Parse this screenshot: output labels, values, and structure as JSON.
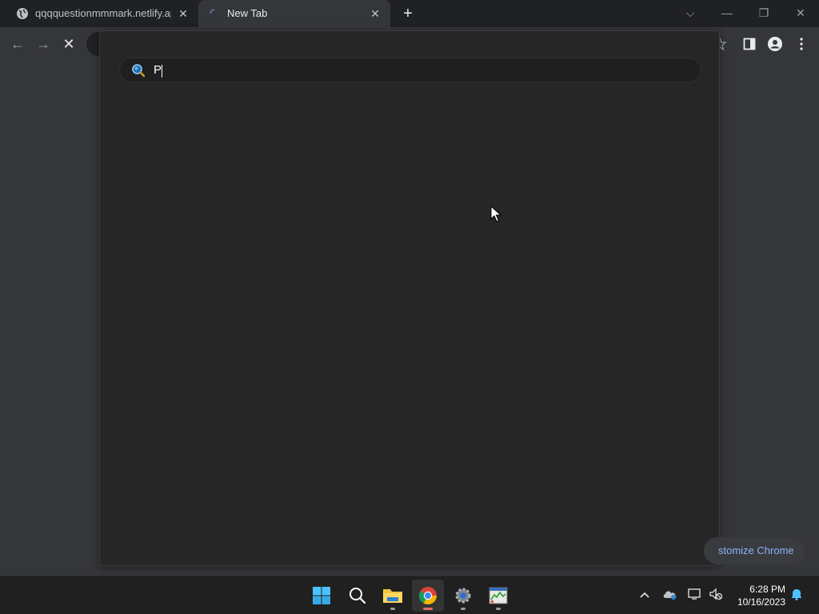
{
  "browser": {
    "tabs": [
      {
        "label": "qqqquestionmmmark.netlify.app",
        "state": "inactive"
      },
      {
        "label": "New Tab",
        "state": "active-loading"
      }
    ],
    "new_tab_symbol": "+",
    "window_controls": {
      "tab_search": "⌵",
      "minimize": "—",
      "restore": "❐",
      "close": "✕"
    }
  },
  "toolbar": {
    "back_symbol": "←",
    "forward_symbol": "→",
    "stop_symbol": "✕",
    "icons": [
      "star-icon",
      "side-panel-icon",
      "profile-icon",
      "menu-icon"
    ]
  },
  "search_popup": {
    "query": "P",
    "search_icon": "search-icon"
  },
  "customize_button": {
    "label": "stomize Chrome"
  },
  "taskbar": {
    "apps": [
      "windows-start",
      "search",
      "file-explorer",
      "chrome",
      "settings",
      "task-manager"
    ],
    "active_app": "chrome",
    "tray": {
      "chevron": "^",
      "time": "6:28 PM",
      "date": "10/16/2023"
    }
  },
  "colors": {
    "window_bg": "#35363a",
    "tabstrip_bg": "#202124",
    "popup_bg": "#262626",
    "accent_blue": "#8ab4f8",
    "taskbar_bg": "#202020"
  }
}
